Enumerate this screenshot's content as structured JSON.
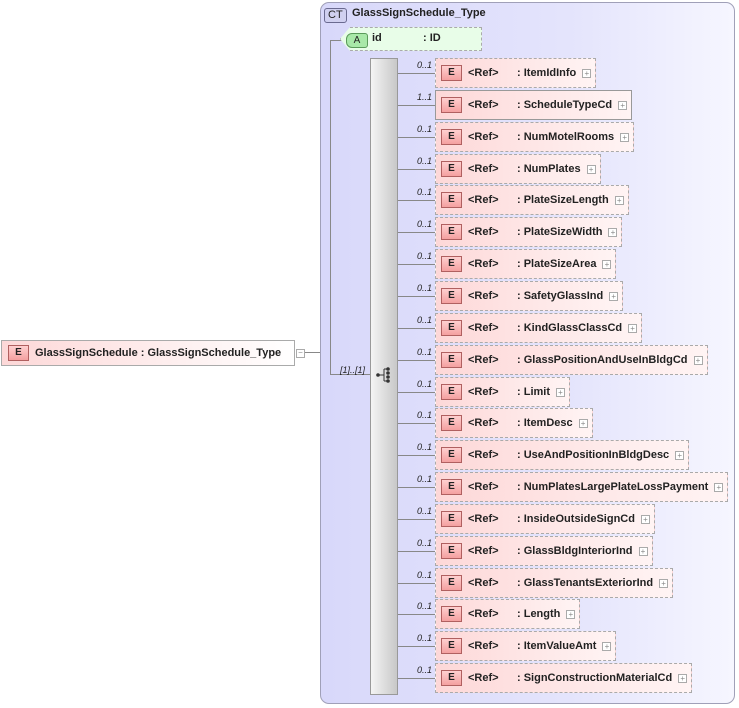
{
  "root": {
    "badge": "E",
    "name": "GlassSignSchedule",
    "type": ": GlassSignSchedule_Type",
    "collapse": "−"
  },
  "complex_type": {
    "badge": "CT",
    "name": "GlassSignSchedule_Type"
  },
  "attribute": {
    "badge": "A",
    "name": "id",
    "type": ": ID"
  },
  "sequence": {
    "cardinality": "[1]..[1]"
  },
  "elements": [
    {
      "card": "0..1",
      "ref": "<Ref>",
      "name": ": ItemIdInfo",
      "required": false
    },
    {
      "card": "1..1",
      "ref": "<Ref>",
      "name": ": ScheduleTypeCd",
      "required": true
    },
    {
      "card": "0..1",
      "ref": "<Ref>",
      "name": ": NumMotelRooms",
      "required": false
    },
    {
      "card": "0..1",
      "ref": "<Ref>",
      "name": ": NumPlates",
      "required": false
    },
    {
      "card": "0..1",
      "ref": "<Ref>",
      "name": ": PlateSizeLength",
      "required": false
    },
    {
      "card": "0..1",
      "ref": "<Ref>",
      "name": ": PlateSizeWidth",
      "required": false
    },
    {
      "card": "0..1",
      "ref": "<Ref>",
      "name": ": PlateSizeArea",
      "required": false
    },
    {
      "card": "0..1",
      "ref": "<Ref>",
      "name": ": SafetyGlassInd",
      "required": false
    },
    {
      "card": "0..1",
      "ref": "<Ref>",
      "name": ": KindGlassClassCd",
      "required": false
    },
    {
      "card": "0..1",
      "ref": "<Ref>",
      "name": ": GlassPositionAndUseInBldgCd",
      "required": false
    },
    {
      "card": "0..1",
      "ref": "<Ref>",
      "name": ": Limit",
      "required": false
    },
    {
      "card": "0..1",
      "ref": "<Ref>",
      "name": ": ItemDesc",
      "required": false
    },
    {
      "card": "0..1",
      "ref": "<Ref>",
      "name": ": UseAndPositionInBldgDesc",
      "required": false
    },
    {
      "card": "0..1",
      "ref": "<Ref>",
      "name": ": NumPlatesLargePlateLossPayment",
      "required": false
    },
    {
      "card": "0..1",
      "ref": "<Ref>",
      "name": ": InsideOutsideSignCd",
      "required": false
    },
    {
      "card": "0..1",
      "ref": "<Ref>",
      "name": ": GlassBldgInteriorInd",
      "required": false
    },
    {
      "card": "0..1",
      "ref": "<Ref>",
      "name": ": GlassTenantsExteriorInd",
      "required": false
    },
    {
      "card": "0..1",
      "ref": "<Ref>",
      "name": ": Length",
      "required": false
    },
    {
      "card": "0..1",
      "ref": "<Ref>",
      "name": ": ItemValueAmt",
      "required": false
    },
    {
      "card": "0..1",
      "ref": "<Ref>",
      "name": ": SignConstructionMaterialCd",
      "required": false
    }
  ],
  "element_badge": "E",
  "expand_symbol": "+"
}
